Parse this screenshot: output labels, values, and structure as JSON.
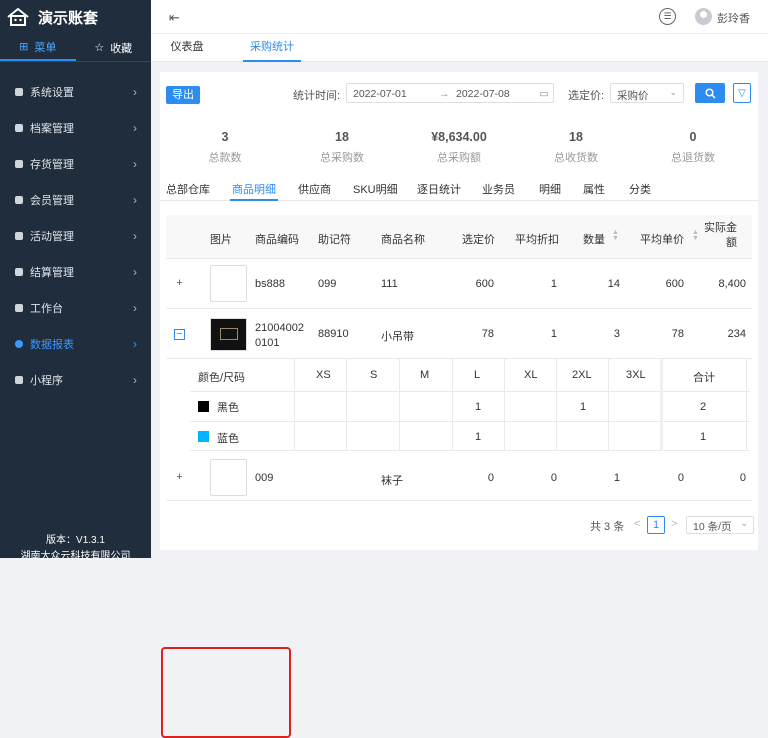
{
  "app": {
    "title": "演示账套",
    "version": "版本：V1.3.1",
    "company": "湖南大众云科技有限公司"
  },
  "sidebar": {
    "tabs": [
      {
        "label": "菜单",
        "icon": "grid-icon"
      },
      {
        "label": "收藏",
        "icon": "star-icon"
      }
    ],
    "items": [
      {
        "label": "系统设置"
      },
      {
        "label": "档案管理"
      },
      {
        "label": "存货管理"
      },
      {
        "label": "会员管理"
      },
      {
        "label": "活动管理"
      },
      {
        "label": "结算管理"
      },
      {
        "label": "工作台"
      },
      {
        "label": "数据报表"
      },
      {
        "label": "小程序"
      }
    ]
  },
  "topbar": {
    "user": "彭玲香"
  },
  "page_tabs": [
    {
      "label": "仪表盘"
    },
    {
      "label": "采购统计"
    }
  ],
  "toolbar": {
    "export": "导出",
    "date_label": "统计时间:",
    "date_start": "2022-07-01",
    "date_end": "2022-07-08",
    "price_label": "选定价:",
    "price_value": "采购价"
  },
  "stats": [
    {
      "value": "3",
      "label": "总款数"
    },
    {
      "value": "18",
      "label": "总采购数"
    },
    {
      "value": "¥8,634.00",
      "label": "总采购额"
    },
    {
      "value": "18",
      "label": "总收货数"
    },
    {
      "value": "0",
      "label": "总退货数"
    }
  ],
  "subtabs": [
    "总部仓库",
    "商品明细",
    "供应商",
    "SKU明细",
    "逐日统计",
    "业务员",
    "明细",
    "属性",
    "分类"
  ],
  "table": {
    "headers": {
      "img": "图片",
      "code": "商品编码",
      "mnemonic": "助记符",
      "name": "商品名称",
      "price": "选定价",
      "discount": "平均折扣",
      "qty": "数量",
      "unit": "平均单价",
      "amount": "实际金额"
    },
    "rows": [
      {
        "code": "bs888",
        "mnemonic": "099",
        "name": "111",
        "price": "600",
        "discount": "1",
        "qty": "14",
        "unit": "600",
        "amount": "8,400"
      },
      {
        "code_line1": "21004002",
        "code_line2": "0101",
        "mnemonic": "88910",
        "name": "小吊带",
        "price": "78",
        "discount": "1",
        "qty": "3",
        "unit": "78",
        "amount": "234"
      },
      {
        "code": "009",
        "mnemonic": "",
        "name": "袜子",
        "price": "0",
        "discount": "0",
        "qty": "1",
        "unit": "0",
        "amount": "0"
      }
    ]
  },
  "sizetable": {
    "header": "颜色/尺码",
    "sizes": [
      "XS",
      "S",
      "M",
      "L",
      "XL",
      "2XL",
      "3XL"
    ],
    "total": "合计",
    "rows": [
      {
        "color": "黑色",
        "swatch": "#000000",
        "L": "1",
        "2XL": "1",
        "total": "2"
      },
      {
        "color": "蓝色",
        "swatch": "#00b4ff",
        "L": "1",
        "total": "1"
      }
    ]
  },
  "pagination": {
    "total": "共 3 条",
    "prev": "<",
    "page": "1",
    "next": ">",
    "size": "10 条/页"
  },
  "colors": {
    "primary": "#2d8cf0",
    "sidebar": "#1f2d3d",
    "highlight": "#e02020"
  }
}
